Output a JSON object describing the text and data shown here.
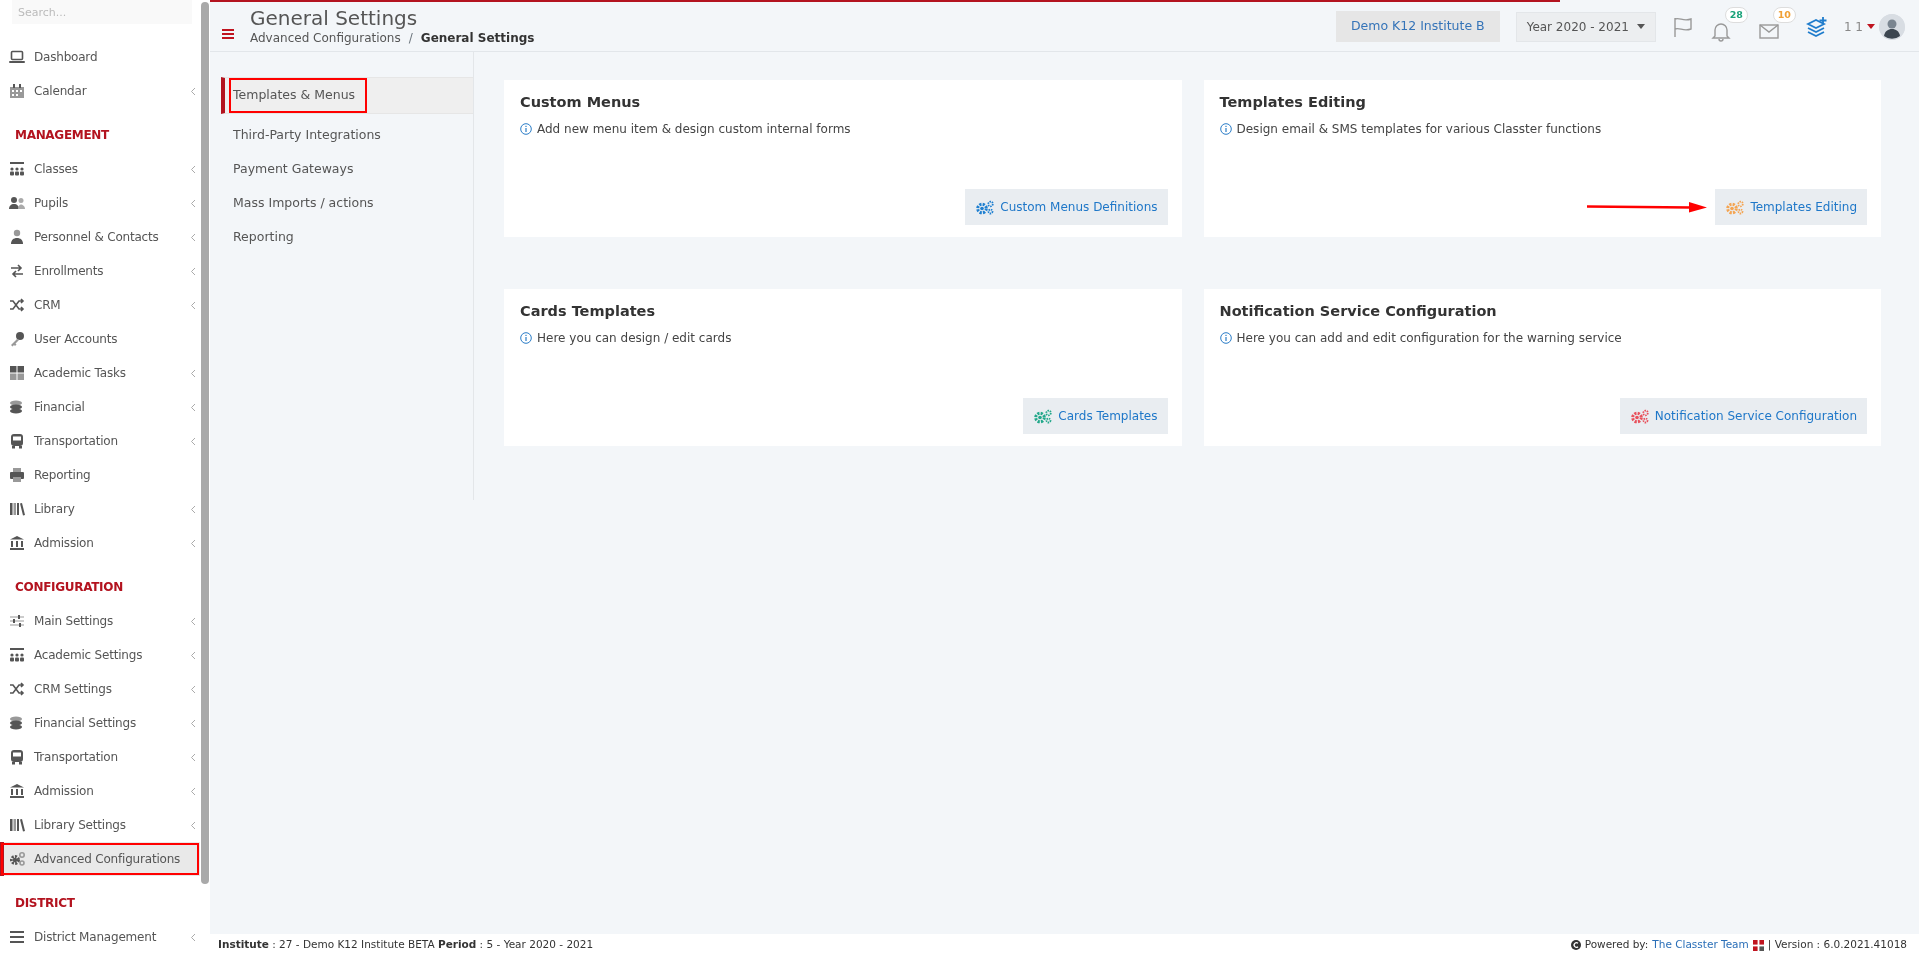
{
  "header": {
    "loading_bar": {
      "level": 0.79
    },
    "title": "General Settings",
    "breadcrumb_separator": "/",
    "breadcrumb": [
      {
        "label": "Advanced Configurations",
        "current": false
      },
      {
        "label": "General Settings",
        "current": true
      }
    ],
    "institute": "Demo K12 Institute B",
    "period": "Year 2020 - 2021",
    "notifications": {
      "count": "28"
    },
    "messages": {
      "count": "10"
    },
    "user": "1 1"
  },
  "sidebar": {
    "search": {
      "placeholder": "Search..."
    },
    "sections": [
      {
        "items": [
          {
            "label": "Dashboard",
            "selected": false,
            "has_submenu": false,
            "annotated": false
          },
          {
            "label": "Calendar",
            "selected": false,
            "has_submenu": true,
            "annotated": false
          }
        ]
      },
      {
        "title": "MANAGEMENT",
        "items": [
          {
            "label": "Classes",
            "selected": false,
            "has_submenu": true,
            "annotated": false
          },
          {
            "label": "Pupils",
            "selected": false,
            "has_submenu": true,
            "annotated": false
          },
          {
            "label": "Personnel & Contacts",
            "selected": false,
            "has_submenu": true,
            "annotated": false
          },
          {
            "label": "Enrollments",
            "selected": false,
            "has_submenu": true,
            "annotated": false
          },
          {
            "label": "CRM",
            "selected": false,
            "has_submenu": true,
            "annotated": false
          },
          {
            "label": "User Accounts",
            "selected": false,
            "has_submenu": false,
            "annotated": false
          },
          {
            "label": "Academic Tasks",
            "selected": false,
            "has_submenu": true,
            "annotated": false
          },
          {
            "label": "Financial",
            "selected": false,
            "has_submenu": true,
            "annotated": false
          },
          {
            "label": "Transportation",
            "selected": false,
            "has_submenu": true,
            "annotated": false
          },
          {
            "label": "Reporting",
            "selected": false,
            "has_submenu": false,
            "annotated": false
          },
          {
            "label": "Library",
            "selected": false,
            "has_submenu": true,
            "annotated": false
          },
          {
            "label": "Admission",
            "selected": false,
            "has_submenu": true,
            "annotated": false
          }
        ]
      },
      {
        "title": "CONFIGURATION",
        "items": [
          {
            "label": "Main Settings",
            "selected": false,
            "has_submenu": true,
            "annotated": false
          },
          {
            "label": "Academic Settings",
            "selected": false,
            "has_submenu": true,
            "annotated": false
          },
          {
            "label": "CRM Settings",
            "selected": false,
            "has_submenu": true,
            "annotated": false
          },
          {
            "label": "Financial Settings",
            "selected": false,
            "has_submenu": true,
            "annotated": false
          },
          {
            "label": "Transportation",
            "selected": false,
            "has_submenu": true,
            "annotated": false
          },
          {
            "label": "Admission",
            "selected": false,
            "has_submenu": true,
            "annotated": false
          },
          {
            "label": "Library Settings",
            "selected": false,
            "has_submenu": true,
            "annotated": false
          },
          {
            "label": "Advanced Configurations",
            "selected": true,
            "has_submenu": false,
            "annotated": true
          }
        ]
      },
      {
        "title": "DISTRICT",
        "items": [
          {
            "label": "District Management",
            "selected": false,
            "has_submenu": true,
            "annotated": false
          }
        ]
      }
    ]
  },
  "submenu": [
    {
      "label": "Templates & Menus",
      "selected": true,
      "annotated": true
    },
    {
      "label": "Third-Party Integrations",
      "selected": false,
      "annotated": false
    },
    {
      "label": "Payment Gateways",
      "selected": false,
      "annotated": false
    },
    {
      "label": "Mass Imports / actions",
      "selected": false,
      "annotated": false
    },
    {
      "label": "Reporting",
      "selected": false,
      "annotated": false
    }
  ],
  "cards": [
    {
      "title": "Custom Menus",
      "description": "Add new menu item & design custom internal forms",
      "button": {
        "label": "Custom Menus Definitions",
        "color": "#1e7fd0"
      },
      "arrow": false
    },
    {
      "title": "Templates Editing",
      "description": "Design email & SMS templates for various Classter functions",
      "button": {
        "label": "Templates Editing",
        "color": "#f4a451"
      },
      "arrow": true
    },
    {
      "title": "Cards Templates",
      "description": "Here you can design / edit cards",
      "button": {
        "label": "Cards Templates",
        "color": "#22a88a"
      },
      "arrow": false
    },
    {
      "title": "Notification Service Configuration",
      "description": "Here you can add and edit configuration for the warning service",
      "button": {
        "label": "Notification Service Configuration",
        "color": "#e8505b"
      },
      "arrow": false
    }
  ],
  "footer": {
    "info": "**Institute** : 27 - Demo K12 Institute BETA **Period** : 5 - Year 2020 - 2021",
    "powered_by": "Powered by:",
    "team": "The Classter Team",
    "version": "| Version : 6.0.2021.41018"
  }
}
